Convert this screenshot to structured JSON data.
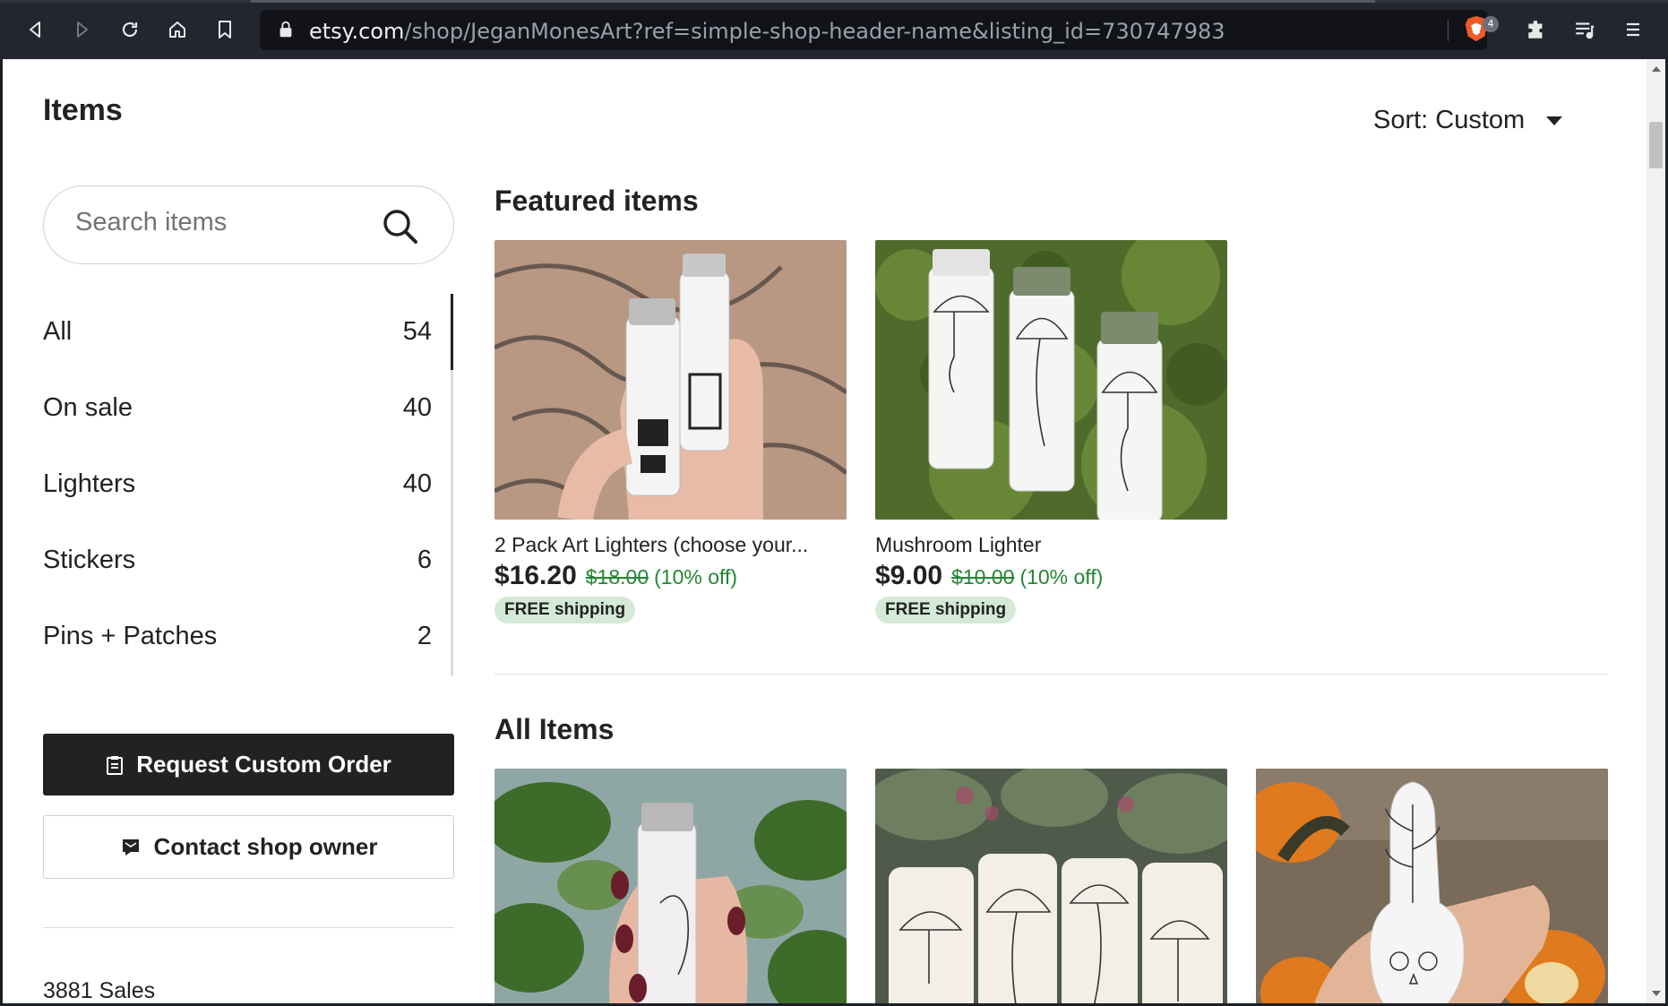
{
  "browser": {
    "url_host": "etsy.com",
    "url_path": "/shop/JeganMonesArt?ref=simple-shop-header-name&listing_id=730747983",
    "brave_badge": "4"
  },
  "page": {
    "items_title": "Items",
    "sort_label": "Sort: Custom",
    "search_placeholder": "Search items",
    "categories": [
      {
        "label": "All",
        "count": "54"
      },
      {
        "label": "On sale",
        "count": "40"
      },
      {
        "label": "Lighters",
        "count": "40"
      },
      {
        "label": "Stickers",
        "count": "6"
      },
      {
        "label": "Pins + Patches",
        "count": "2"
      }
    ],
    "request_custom_order": "Request Custom Order",
    "contact_shop_owner": "Contact shop owner",
    "sales": "3881 Sales",
    "featured_heading": "Featured items",
    "featured": [
      {
        "title": "2 Pack Art Lighters (choose your...",
        "price": "$16.20",
        "original": "$18.00",
        "discount": "(10% off)",
        "shipping": "FREE shipping"
      },
      {
        "title": "Mushroom Lighter",
        "price": "$9.00",
        "original": "$10.00",
        "discount": "(10% off)",
        "shipping": "FREE shipping"
      }
    ],
    "all_items_heading": "All Items"
  }
}
